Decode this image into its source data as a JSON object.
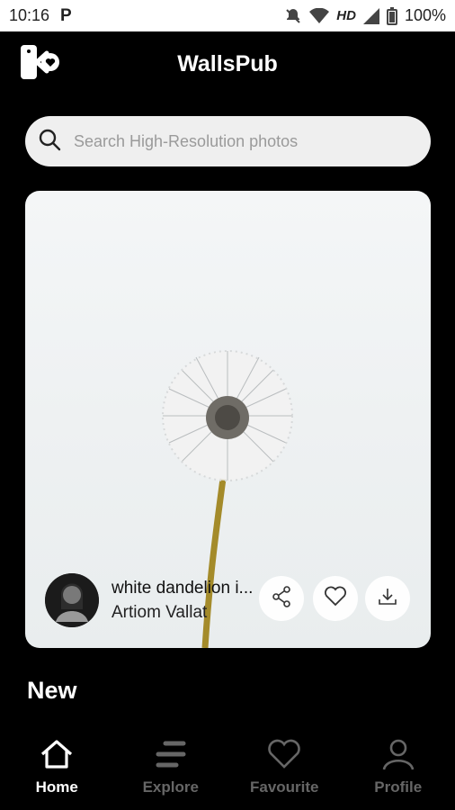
{
  "status_bar": {
    "time": "10:16",
    "carrier_icon": "P",
    "network": "HD",
    "battery": "100%"
  },
  "app": {
    "title": "WallsPub"
  },
  "search": {
    "placeholder": "Search High-Resolution photos"
  },
  "featured": {
    "title": "white dandelion i...",
    "author": "Artiom Vallat",
    "actions": [
      "share-icon",
      "heart-icon",
      "download-icon"
    ]
  },
  "sections": {
    "new_title": "New"
  },
  "bottom_nav": {
    "items": [
      {
        "label": "Home",
        "icon": "home-icon",
        "active": true
      },
      {
        "label": "Explore",
        "icon": "explore-icon",
        "active": false
      },
      {
        "label": "Favourite",
        "icon": "heart-icon",
        "active": false
      },
      {
        "label": "Profile",
        "icon": "profile-icon",
        "active": false
      }
    ]
  },
  "colors": {
    "background": "#000000",
    "accent_active": "#ffffff",
    "inactive": "#666666",
    "search_bg": "#efefef"
  }
}
